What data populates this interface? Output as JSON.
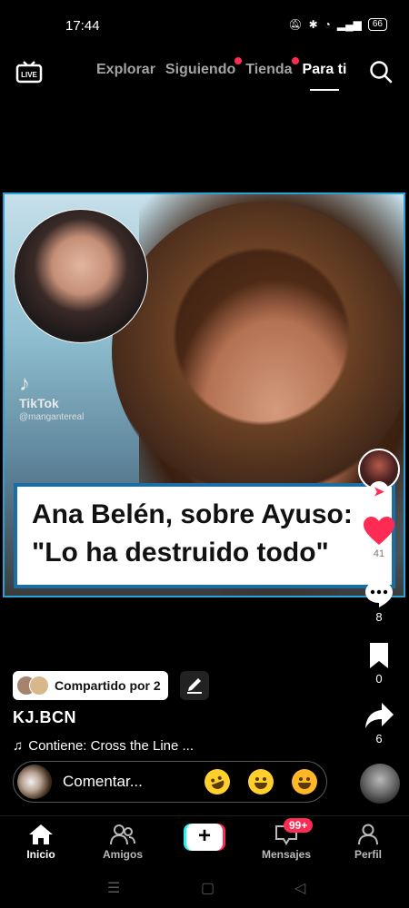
{
  "status_bar": {
    "time": "17:44",
    "battery": "66"
  },
  "top_nav": {
    "live_label": "LIVE",
    "tabs": [
      {
        "label": "Explorar",
        "dot": false,
        "active": false
      },
      {
        "label": "Siguiendo",
        "dot": true,
        "active": false
      },
      {
        "label": "Tienda",
        "dot": true,
        "active": false
      },
      {
        "label": "Para ti",
        "dot": false,
        "active": true
      }
    ]
  },
  "video": {
    "watermark_brand": "TikTok",
    "watermark_handle": "@mangantereal",
    "caption_line1": "Ana Belén, sobre Ayuso:",
    "caption_line2": "\"Lo ha destruido todo\""
  },
  "actions": {
    "likes": "41",
    "comments": "8",
    "saves": "0",
    "shares": "6"
  },
  "post": {
    "shared_label": "Compartido por 2",
    "username": "KJ.BCN",
    "music": "Contiene: Cross the Line ..."
  },
  "comment": {
    "placeholder": "Comentar..."
  },
  "bottom_nav": {
    "items": [
      "Inicio",
      "Amigos",
      "Mensajes",
      "Perfil"
    ],
    "messages_badge": "99+"
  },
  "colors": {
    "accent": "#fe2c55",
    "accent_secondary": "#25f4ee",
    "background": "#000000"
  }
}
